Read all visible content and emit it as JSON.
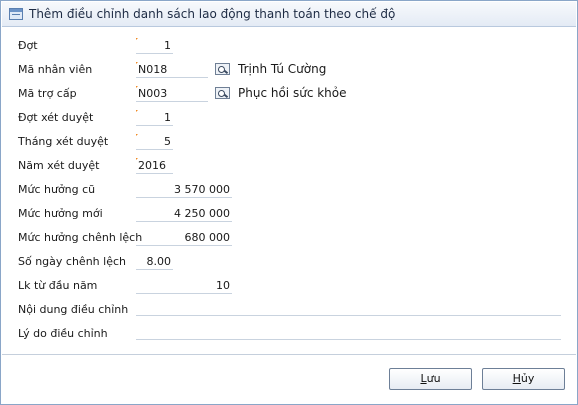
{
  "window": {
    "title": "Thêm điều chỉnh danh sách lao động thanh toán theo chế độ"
  },
  "form": {
    "dot": {
      "label": "Đợt",
      "value": "1"
    },
    "ma_nhan_vien": {
      "label": "Mã nhân viên",
      "value": "N018",
      "description": "Trịnh Tú Cường"
    },
    "ma_tro_cap": {
      "label": "Mã trợ cấp",
      "value": "N003",
      "description": "Phục hồi sức khỏe"
    },
    "dot_xet_duyet": {
      "label": "Đợt xét duyệt",
      "value": "1"
    },
    "thang_xet_duyet": {
      "label": "Tháng xét duyệt",
      "value": "5"
    },
    "nam_xet_duyet": {
      "label": "Năm xét duyệt",
      "value": "2016"
    },
    "muc_huong_cu": {
      "label": "Mức hưởng cũ",
      "value": "3 570 000"
    },
    "muc_huong_moi": {
      "label": "Mức hưởng mới",
      "value": "4 250 000"
    },
    "muc_huong_chenh_lech": {
      "label": "Mức hưởng chênh lệch",
      "value": "680 000"
    },
    "so_ngay_chenh_lech": {
      "label": "Số ngày chênh lệch",
      "value": "8.00"
    },
    "lk_tu_dau_nam": {
      "label": "Lk từ đầu năm",
      "value": "10"
    },
    "noi_dung_dieu_chinh": {
      "label": "Nội dung điều chỉnh",
      "value": ""
    },
    "ly_do_dieu_chinh": {
      "label": "Lý do điều chỉnh",
      "value": ""
    }
  },
  "buttons": {
    "save": {
      "mnemonic": "L",
      "rest": "ưu"
    },
    "cancel": {
      "mnemonic": "H",
      "rest": "ủy"
    }
  },
  "icons": {
    "title": "form-icon",
    "lookup": "lookup-icon"
  },
  "colors": {
    "required_marker": "#f08a24",
    "border": "#8aa6c8"
  }
}
